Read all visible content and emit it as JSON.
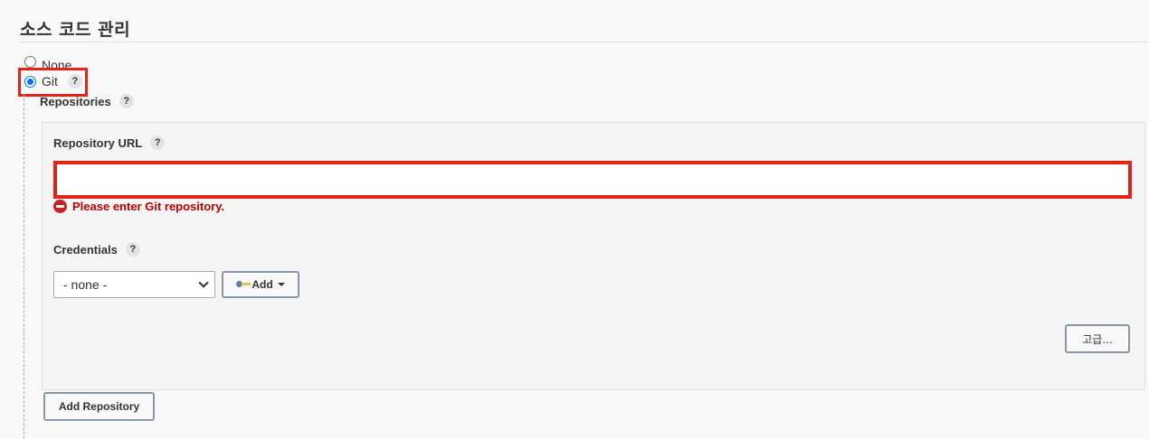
{
  "section": {
    "title": "소스 코드 관리"
  },
  "scm_options": {
    "none_label": "None",
    "git_label": "Git",
    "selected": "Git"
  },
  "help_glyph": "?",
  "repositories": {
    "label": "Repositories",
    "repository_url": {
      "label": "Repository URL",
      "value": "",
      "error": "Please enter Git repository."
    },
    "credentials": {
      "label": "Credentials",
      "selected": "- none -",
      "add_label": "Add"
    },
    "advanced_label": "고급...",
    "add_repository_label": "Add Repository"
  },
  "colors": {
    "highlight": "#e2231a",
    "error_text": "#bb0000",
    "radio_checked": "#0075ff"
  },
  "icons": {
    "help": "question-mark-circle",
    "error": "no-entry-sign",
    "key": "key-icon",
    "dropdown": "chevron-down-icon",
    "add_caret": "caret-down-icon"
  }
}
